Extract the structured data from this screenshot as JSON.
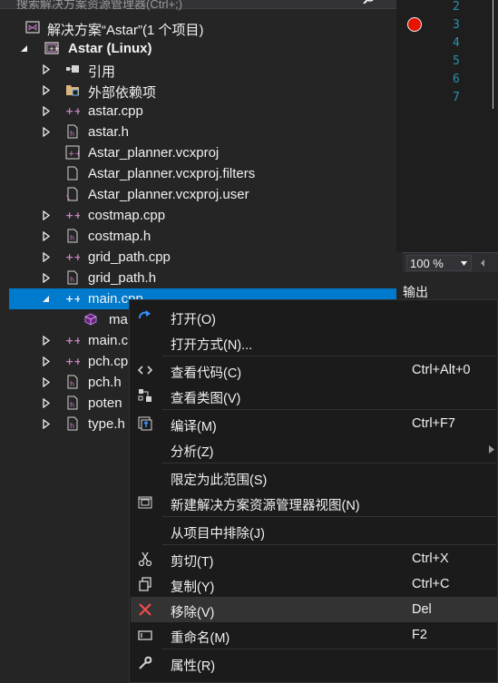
{
  "explorer": {
    "search_placeholder": "搜索解决方案资源管理器(Ctrl+;)",
    "solution_label": "解决方案“Astar”(1 个项目)",
    "project_label": "Astar (Linux)",
    "items": [
      {
        "label": "引用"
      },
      {
        "label": "外部依赖项"
      },
      {
        "label": "astar.cpp"
      },
      {
        "label": "astar.h"
      },
      {
        "label": "Astar_planner.vcxproj"
      },
      {
        "label": "Astar_planner.vcxproj.filters"
      },
      {
        "label": "Astar_planner.vcxproj.user"
      },
      {
        "label": "costmap.cpp"
      },
      {
        "label": "costmap.h"
      },
      {
        "label": "grid_path.cpp"
      },
      {
        "label": "grid_path.h"
      },
      {
        "label": "main.cpp"
      },
      {
        "label": "ma"
      },
      {
        "label": "main.c"
      },
      {
        "label": "pch.cp"
      },
      {
        "label": "pch.h"
      },
      {
        "label": "poten"
      },
      {
        "label": "type.h"
      }
    ]
  },
  "editor": {
    "line_numbers": [
      "2",
      "3",
      "4",
      "5",
      "6",
      "7"
    ],
    "zoom": "100 %",
    "output_tab": "输出"
  },
  "context_menu": {
    "items": [
      {
        "label": "打开(O)",
        "shortcut": "",
        "icon": "open-arrow-icon"
      },
      {
        "label": "打开方式(N)...",
        "shortcut": "",
        "icon": ""
      },
      {
        "label": "查看代码(C)",
        "shortcut": "Ctrl+Alt+0",
        "icon": "code-icon"
      },
      {
        "label": "查看类图(V)",
        "shortcut": "",
        "icon": "class-diagram-icon"
      },
      {
        "label": "编译(M)",
        "shortcut": "Ctrl+F7",
        "icon": "compile-icon"
      },
      {
        "label": "分析(Z)",
        "shortcut": "",
        "icon": ""
      },
      {
        "label": "限定为此范围(S)",
        "shortcut": "",
        "icon": ""
      },
      {
        "label": "新建解决方案资源管理器视图(N)",
        "shortcut": "",
        "icon": "new-view-icon"
      },
      {
        "label": "从项目中排除(J)",
        "shortcut": "",
        "icon": ""
      },
      {
        "label": "剪切(T)",
        "shortcut": "Ctrl+X",
        "icon": "scissors-icon"
      },
      {
        "label": "复制(Y)",
        "shortcut": "Ctrl+C",
        "icon": "copy-icon"
      },
      {
        "label": "移除(V)",
        "shortcut": "Del",
        "icon": "remove-x-icon"
      },
      {
        "label": "重命名(M)",
        "shortcut": "F2",
        "icon": "rename-icon"
      },
      {
        "label": "属性(R)",
        "shortcut": "",
        "icon": "wrench-icon"
      }
    ]
  },
  "colors": {
    "selection": "#007acc",
    "panel_bg": "#252526",
    "menu_bg": "#1b1b1c",
    "cpp_icon": "#c586c0",
    "breakpoint": "#e51400"
  }
}
